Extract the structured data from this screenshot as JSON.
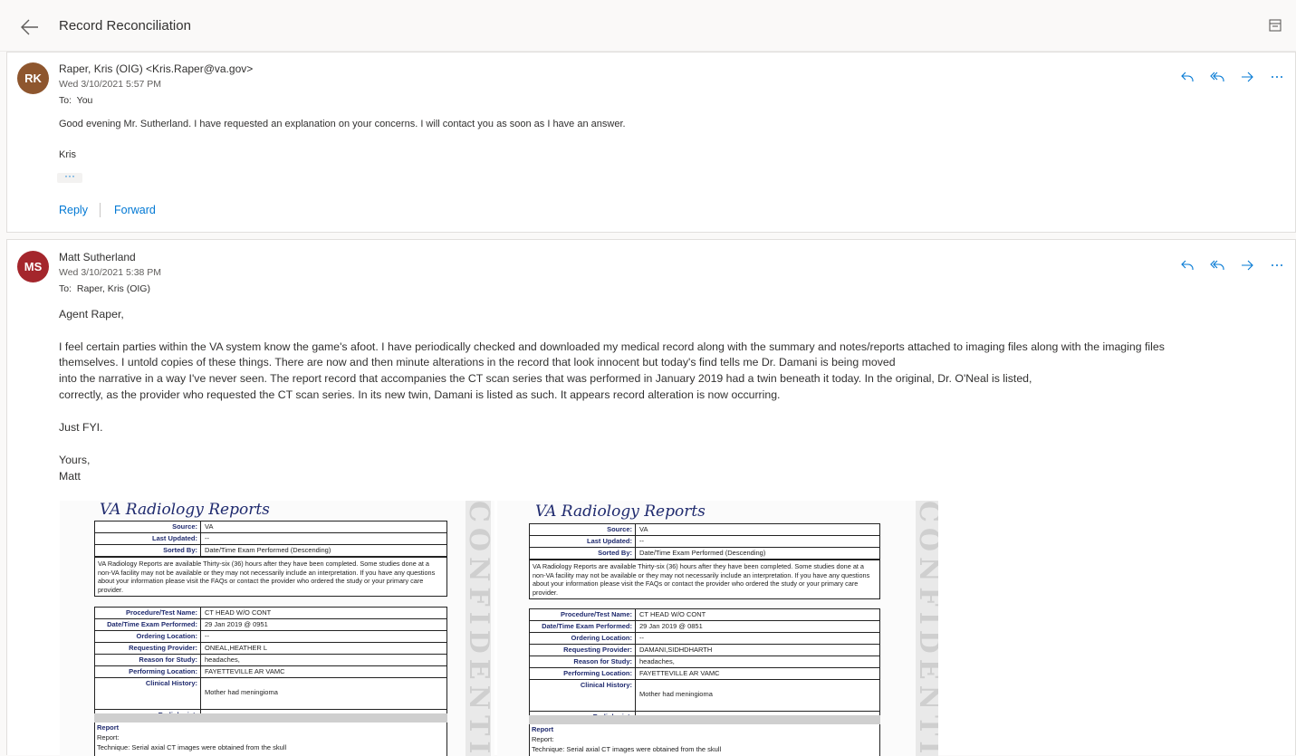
{
  "header": {
    "subject": "Record Reconciliation"
  },
  "message1": {
    "avatar_initials": "RK",
    "avatar_color": "#8e562e",
    "sender": "Raper, Kris (OIG) <Kris.Raper@va.gov>",
    "date": "Wed 3/10/2021 5:57 PM",
    "to_label": "To:",
    "to": "You",
    "body_line1": "Good evening Mr. Sutherland. I have requested an explanation on your concerns. I will contact you as soon as I have an answer.",
    "signature": "Kris",
    "ellipsis": "···",
    "reply": "Reply",
    "forward": "Forward"
  },
  "message2": {
    "avatar_initials": "MS",
    "avatar_color": "#a4262c",
    "sender": "Matt Sutherland",
    "date": "Wed 3/10/2021 5:38 PM",
    "to_label": "To:",
    "to": "Raper, Kris (OIG)",
    "greeting": "Agent Raper,",
    "para_lines": [
      "I feel certain parties within the VA system know the game's afoot. I have periodically checked and downloaded my medical record along with the summary and notes/reports attached to imaging files along with the imaging files",
      "themselves. I untold copies of these things. There are now and then minute alterations in the record that look innocent but today's find tells me Dr. Damani is being moved",
      "into the narrative in a way I've never seen. The report record that accompanies the CT scan series that was performed in January 2019 had a twin beneath it today. In the original, Dr. O'Neal is listed,",
      "correctly, as the provider who requested the CT scan series. In its new twin, Damani is listed as such. It appears record alteration is now occurring."
    ],
    "fyi": "Just FYI.",
    "closing": "Yours,",
    "name": "Matt"
  },
  "reports": [
    {
      "title": "VA Radiology Reports",
      "watermark": "CONFIDENTIA",
      "source": "VA",
      "last_updated": "--",
      "sorted_by": "Date/Time Exam Performed (Descending)",
      "note": "VA Radiology Reports are available Thirty-six (36) hours after they have been completed. Some studies done at a non-VA facility may not be available or they may not necessarily include an interpretation. If you have any questions about your information please visit the FAQs or contact the provider who ordered the study or your primary care provider.",
      "procedure": "CT HEAD W/O CONT",
      "datetime": "29 Jan 2019 @ 0951",
      "ordering_location": "--",
      "requesting_provider": "ONEAL,HEATHER L",
      "reason": "headaches,",
      "performing_location": "FAYETTEVILLE AR VAMC",
      "clinical_history": "Mother had meningioma",
      "radiologist": "--",
      "report_label": "Report",
      "report_line1": "Report:",
      "report_line2": "Technique: Serial axial CT images were obtained from the skull"
    },
    {
      "title": "VA Radiology Reports",
      "watermark": "CONFIDENTIA",
      "source": "VA",
      "last_updated": "--",
      "sorted_by": "Date/Time Exam Performed (Descending)",
      "note": "VA Radiology Reports are available Thirty-six (36) hours after they have been completed. Some studies done at a non-VA facility may not be available or they may not necessarily include an interpretation. If you have any questions about your information please visit the FAQs or contact the provider who ordered the study or your primary care provider.",
      "procedure": "CT HEAD W/O CONT",
      "datetime": "29 Jan 2019 @ 0851",
      "ordering_location": "--",
      "requesting_provider": "DAMANI,SIDHDHARTH",
      "reason": "headaches,",
      "performing_location": "FAYETTEVILLE AR VAMC",
      "clinical_history": "Mother had meningioma",
      "radiologist": "--",
      "report_label": "Report",
      "report_line1": "Report:",
      "report_line2": "Technique: Serial axial CT images were obtained from the skull"
    }
  ],
  "labels": {
    "source": "Source:",
    "last_updated": "Last Updated:",
    "sorted_by": "Sorted By:",
    "procedure": "Procedure/Test Name:",
    "datetime": "Date/Time Exam Performed:",
    "ordering_location": "Ordering Location:",
    "requesting_provider": "Requesting Provider:",
    "reason": "Reason for Study:",
    "performing_location": "Performing Location:",
    "clinical_history": "Clinical History:",
    "radiologist": "Radiologist:"
  }
}
